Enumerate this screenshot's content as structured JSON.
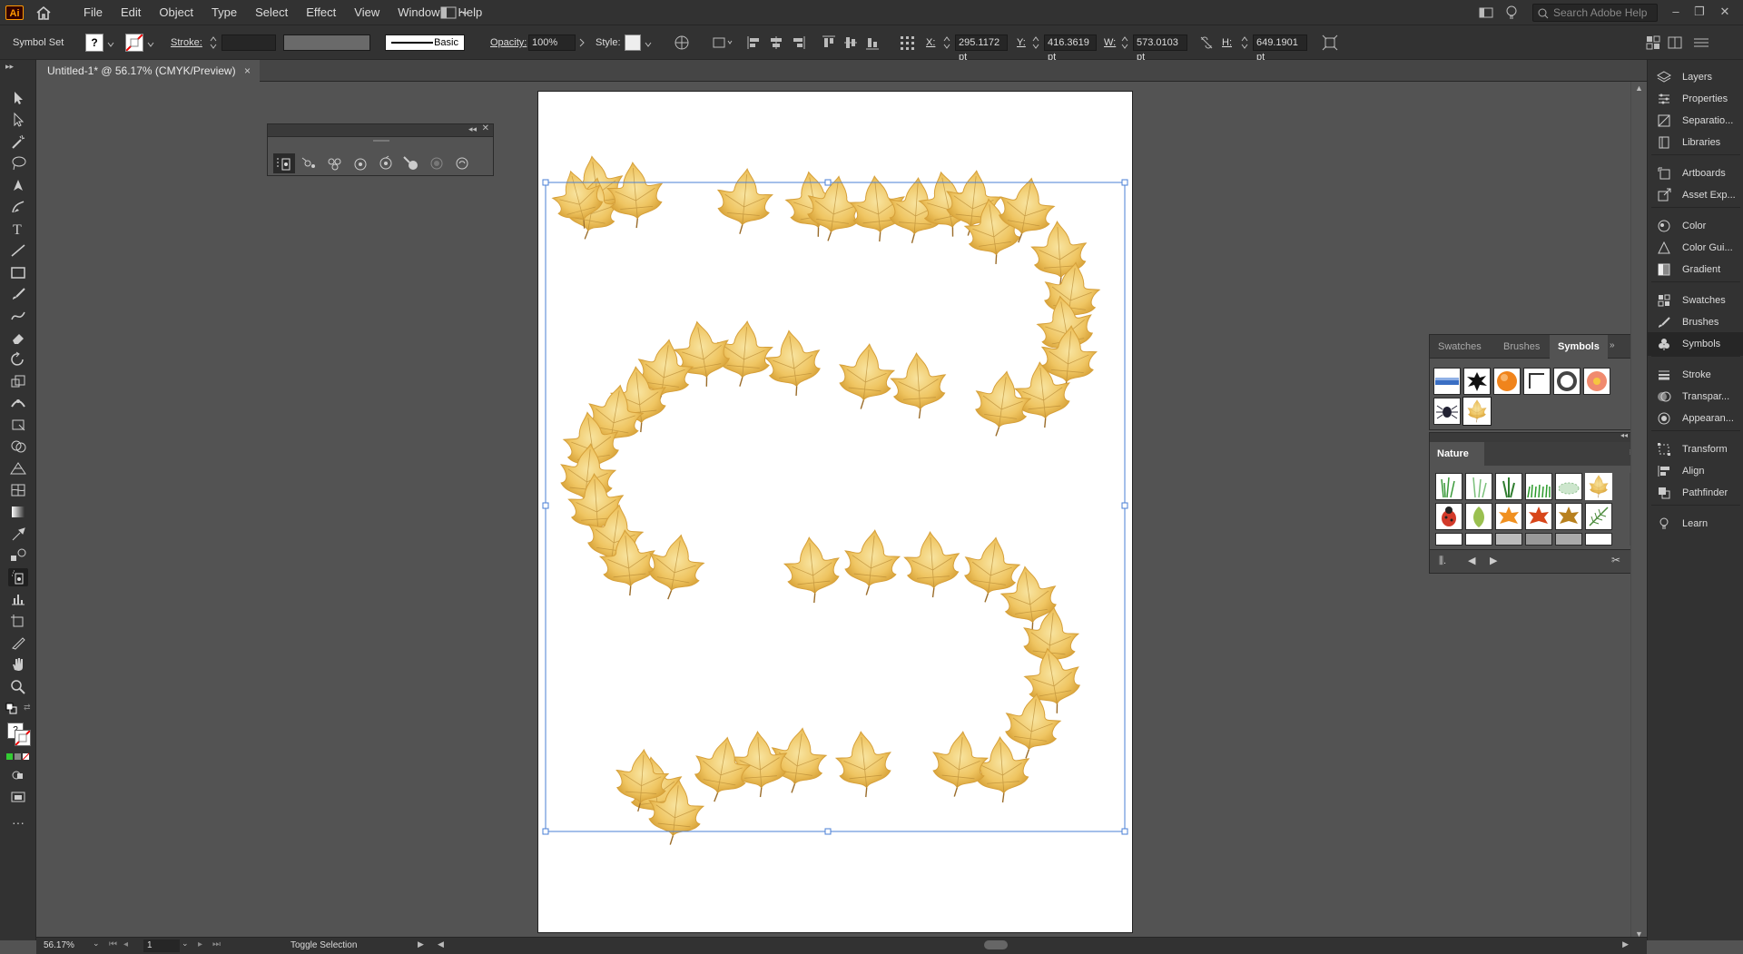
{
  "app": {
    "logo": "Ai"
  },
  "menu": [
    "File",
    "Edit",
    "Object",
    "Type",
    "Select",
    "Effect",
    "View",
    "Window",
    "Help"
  ],
  "search": {
    "placeholder": "Search Adobe Help"
  },
  "control": {
    "selection_label": "Symbol Set",
    "stroke_label": "Stroke:",
    "brush_label": "Basic",
    "opacity_label": "Opacity:",
    "opacity_value": "100%",
    "style_label": "Style:",
    "x_label": "X:",
    "x_value": "295.1172 pt",
    "y_label": "Y:",
    "y_value": "416.3619 pt",
    "w_label": "W:",
    "w_value": "573.0103 pt",
    "h_label": "H:",
    "h_value": "649.1901 pt"
  },
  "document": {
    "tab_title": "Untitled-1* @ 56.17% (CMYK/Preview)",
    "close": "×"
  },
  "dock": [
    {
      "label": "Layers",
      "icon": "layers-icon"
    },
    {
      "label": "Properties",
      "icon": "properties-icon"
    },
    {
      "label": "Separatio...",
      "icon": "separations-icon"
    },
    {
      "label": "Libraries",
      "icon": "libraries-icon"
    },
    {
      "label": "Artboards",
      "icon": "artboards-icon"
    },
    {
      "label": "Asset Exp...",
      "icon": "asset-export-icon"
    },
    {
      "label": "Color",
      "icon": "color-icon"
    },
    {
      "label": "Color Gui...",
      "icon": "color-guide-icon"
    },
    {
      "label": "Gradient",
      "icon": "gradient-icon"
    },
    {
      "label": "Swatches",
      "icon": "swatches-icon"
    },
    {
      "label": "Brushes",
      "icon": "brushes-icon"
    },
    {
      "label": "Symbols",
      "icon": "symbols-icon"
    },
    {
      "label": "Stroke",
      "icon": "stroke-icon"
    },
    {
      "label": "Transpar...",
      "icon": "transparency-icon"
    },
    {
      "label": "Appearan...",
      "icon": "appearance-icon"
    },
    {
      "label": "Transform",
      "icon": "transform-icon"
    },
    {
      "label": "Align",
      "icon": "align-icon"
    },
    {
      "label": "Pathfinder",
      "icon": "pathfinder-icon"
    },
    {
      "label": "Learn",
      "icon": "learn-icon"
    }
  ],
  "symbols_panel": {
    "tabs": [
      "Swatches",
      "Brushes",
      "Symbols"
    ],
    "active_tab": "Symbols",
    "library_name": "Nature"
  },
  "status": {
    "zoom": "56.17%",
    "artboard": "1",
    "tool": "Toggle Selection"
  },
  "colors": {
    "leaf_light": "#f6dc8c",
    "leaf_dark": "#d9a336",
    "leaf_vein": "#a37a2b",
    "selection": "#4a7fd6",
    "ui_dark": "#323232",
    "ui_mid": "#535353"
  }
}
